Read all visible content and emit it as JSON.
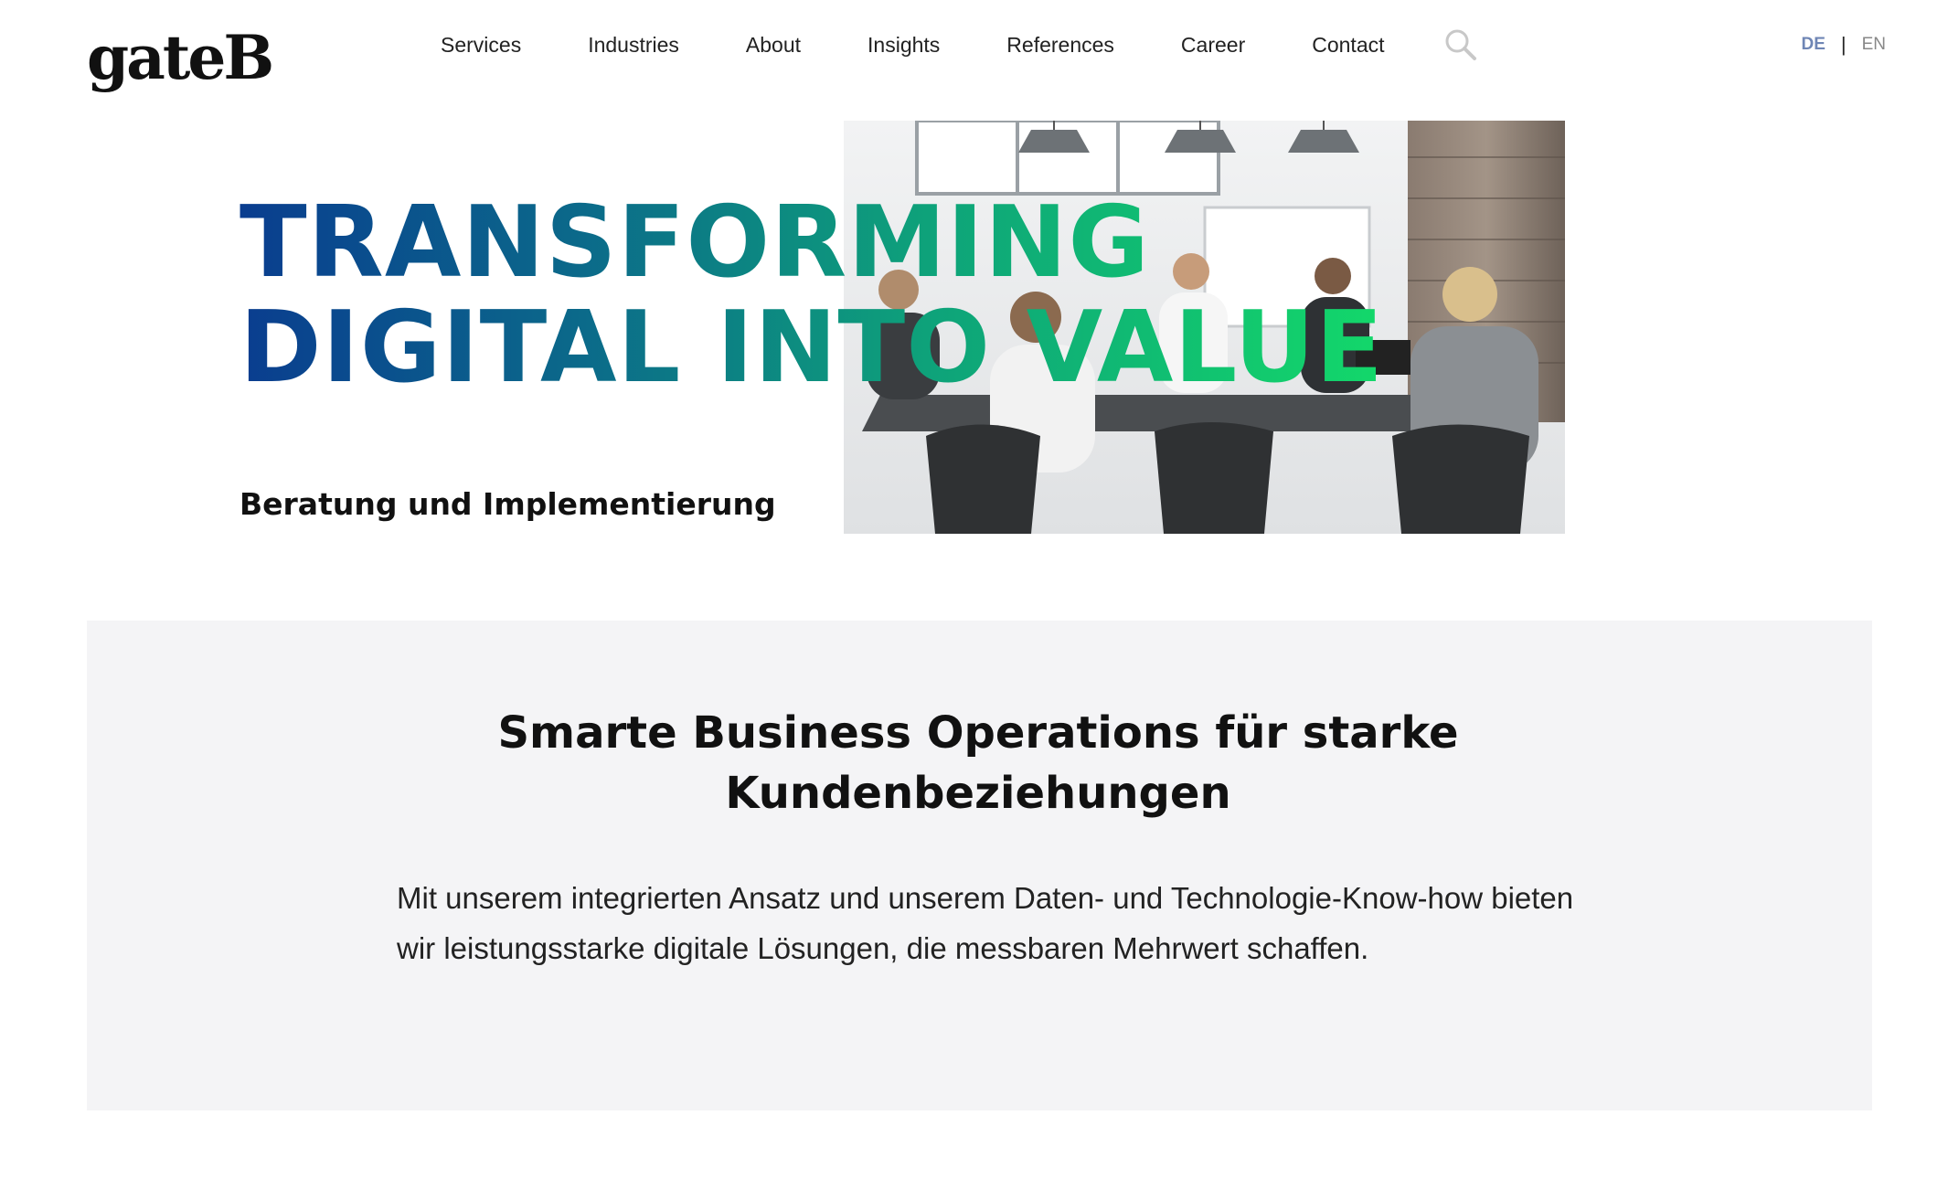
{
  "brand": {
    "logo_text": "gateB"
  },
  "nav": {
    "items": [
      "Services",
      "Industries",
      "About",
      "Insights",
      "References",
      "Career",
      "Contact"
    ],
    "search_icon": "search-icon"
  },
  "language": {
    "active": "DE",
    "separator": "|",
    "other": "EN"
  },
  "hero": {
    "headline_line1": "TRANSFORMING",
    "headline_line2": "DIGITAL INTO VALUE",
    "subtitle": "Beratung und Implementierung",
    "image": "meeting-room-photo"
  },
  "intro": {
    "title": "Smarte Business Operations für starke Kundenbeziehungen",
    "text": "Mit unserem integrierten Ansatz und unserem Daten- und Technologie-Know-how bieten wir leistungsstarke digitale Lösungen, die messbaren Mehrwert schaffen."
  },
  "colors": {
    "gradient_start": "#0a3d8f",
    "gradient_end": "#13d86a",
    "panel_bg": "#f4f4f6",
    "lang_active": "#6f86b5"
  }
}
